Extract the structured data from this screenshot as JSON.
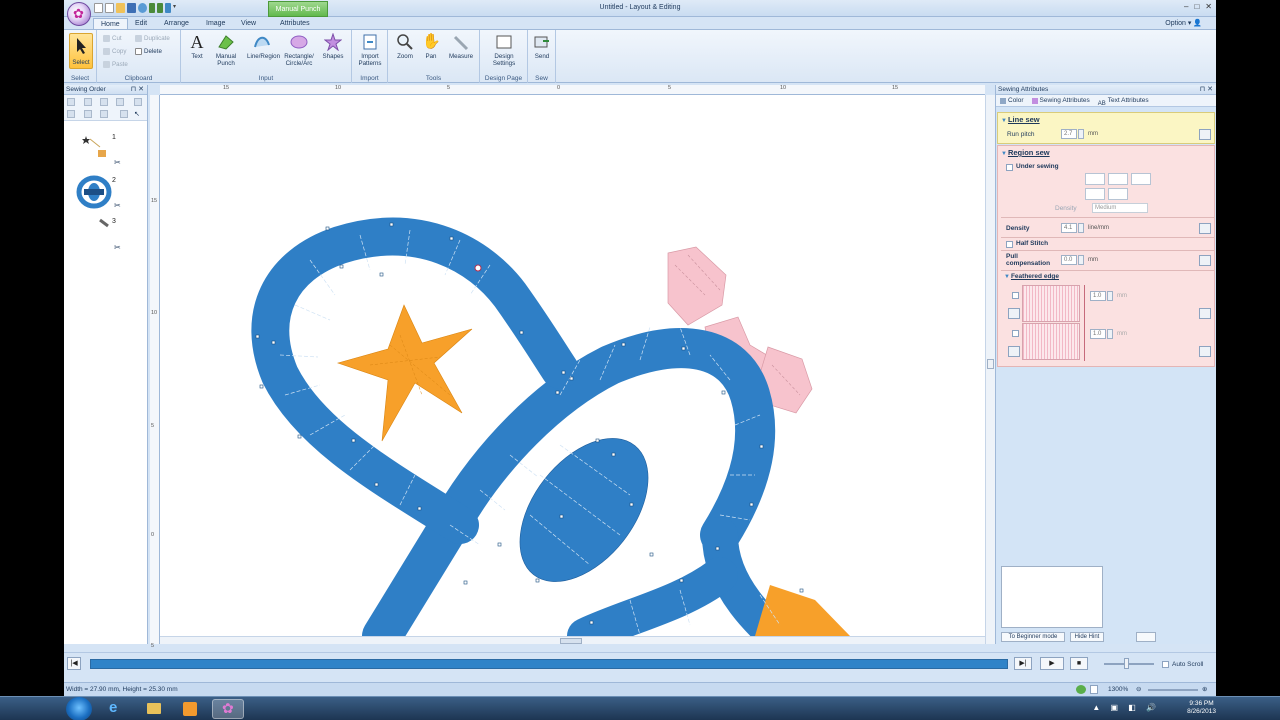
{
  "window": {
    "title": "Untitled - Layout & Editing",
    "context_tab": "Manual Punch"
  },
  "ribbon_tabs": [
    "Home",
    "Edit",
    "Arrange",
    "Image",
    "View",
    "Attributes"
  ],
  "option_label": "Option",
  "ribbon": {
    "select": "Select",
    "cut": "Cut",
    "copy": "Copy",
    "paste": "Paste",
    "duplicate": "Duplicate",
    "delete": "Delete",
    "text": "Text",
    "manual_punch": "Manual Punch",
    "line_region": "Line/Region",
    "rect_circle": "Rectangle/ Circle/Arc",
    "shapes": "Shapes",
    "import_patterns": "Import Patterns",
    "zoom": "Zoom",
    "pan": "Pan",
    "measure": "Measure",
    "design_settings": "Design Settings",
    "send": "Send",
    "groups": {
      "select": "Select",
      "clipboard": "Clipboard",
      "input": "Input",
      "import": "Import",
      "tools": "Tools",
      "design_page": "Design Page",
      "sew": "Sew"
    }
  },
  "sewing_order": {
    "title": "Sewing Order",
    "items": [
      "1",
      "2",
      "3"
    ]
  },
  "ruler": {
    "top": [
      "15",
      "10",
      "5",
      "0",
      "5",
      "10",
      "15"
    ],
    "left": [
      "15",
      "10",
      "5",
      "0",
      "5"
    ]
  },
  "attributes": {
    "title": "Sewing Attributes",
    "tabs": [
      "Color",
      "Sewing Attributes",
      "Text Attributes"
    ],
    "line_sew": {
      "title": "Line sew",
      "run_pitch_label": "Run pitch",
      "run_pitch": "2.7",
      "unit": "mm"
    },
    "region_sew": {
      "title": "Region sew",
      "under_sewing": "Under sewing",
      "density_sub_label": "Density",
      "density_sub_value": "Medium",
      "density_label": "Density",
      "density": "4.1",
      "density_unit": "line/mm",
      "half_stitch": "Half Stitch",
      "pull_label": "Pull compensation",
      "pull": "0.0",
      "pull_unit": "mm",
      "feathered_title": "Feathered edge",
      "feather1": "1.0",
      "feather2": "1.0",
      "feather_unit": "mm"
    },
    "beginner_button": "To Beginner mode",
    "hide_hint_button": "Hide Hint"
  },
  "player": {
    "auto_scroll": "Auto Scroll"
  },
  "status": {
    "size": "Width = 27.90 mm, Height = 25.30 mm",
    "zoom": "1300%"
  },
  "taskbar": {
    "time": "9:36 PM",
    "date": "8/26/2013"
  },
  "colors": {
    "blue_region": "#2f7fc6",
    "orange_star": "#f7a02a",
    "pink_bow": "#f7c3cd",
    "ribbon_bg": "#dbe7f5",
    "line_sew_bg": "#fbf6c4",
    "region_sew_bg": "#fbe1e1"
  }
}
